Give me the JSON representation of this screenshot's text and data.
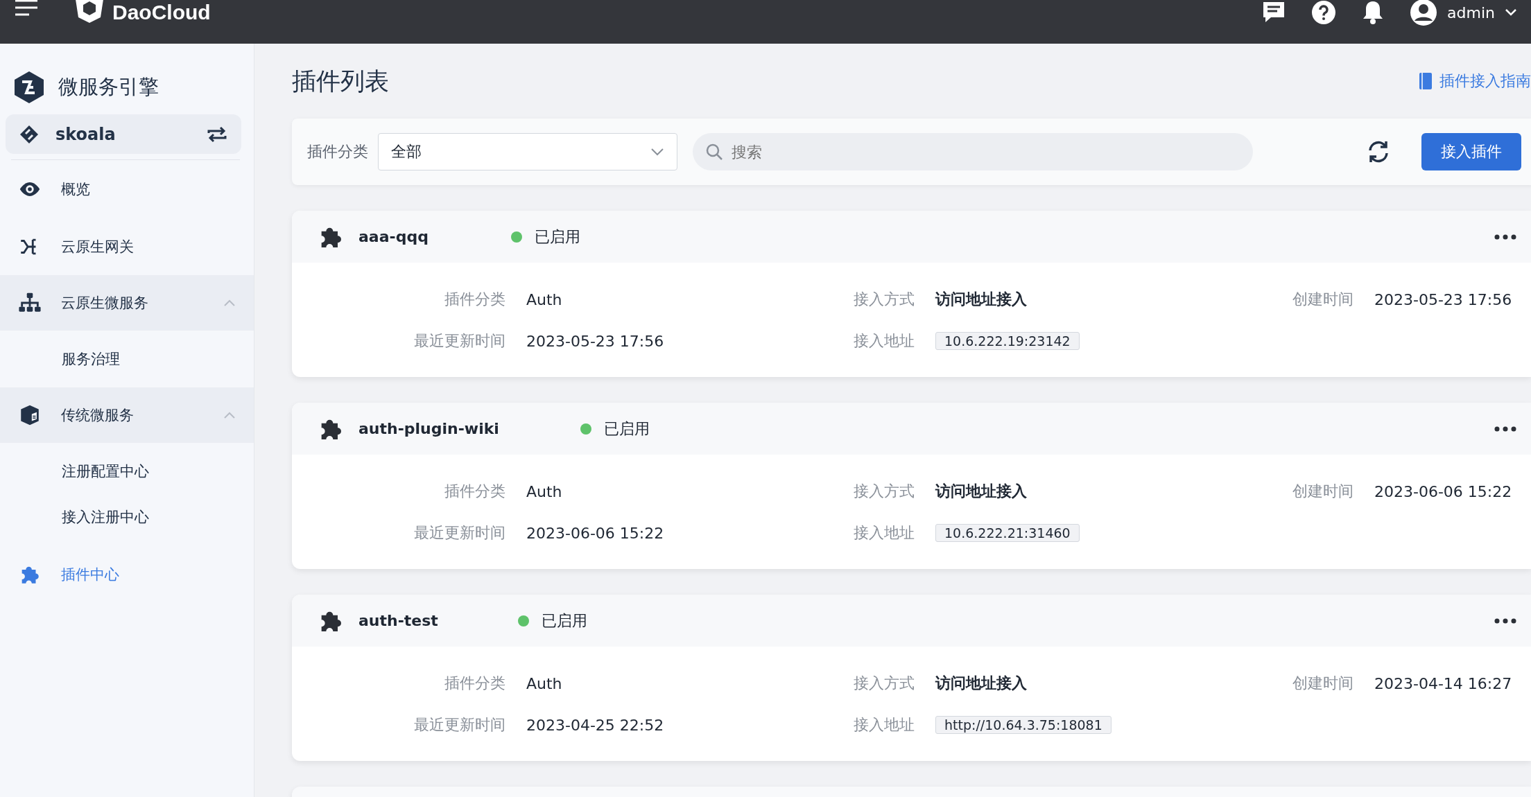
{
  "topbar": {
    "brand": "DaoCloud",
    "user": "admin"
  },
  "sidebar": {
    "title": "微服务引擎",
    "workspace": "skoala",
    "items": [
      {
        "label": "概览",
        "selected": false
      },
      {
        "label": "云原生网关",
        "selected": false
      },
      {
        "label": "云原生微服务",
        "selected": false,
        "expanded": true,
        "children": [
          {
            "label": "服务治理",
            "selected": false
          }
        ]
      },
      {
        "label": "传统微服务",
        "selected": false,
        "expanded": true,
        "children": [
          {
            "label": "注册配置中心",
            "selected": false
          },
          {
            "label": "接入注册中心",
            "selected": false
          }
        ]
      },
      {
        "label": "插件中心",
        "selected": true
      }
    ]
  },
  "page": {
    "title": "插件列表",
    "guide_link": "插件接入指南"
  },
  "toolbar": {
    "category_label": "插件分类",
    "category_value": "全部",
    "search_placeholder": "搜索",
    "add_button": "接入插件"
  },
  "plugins": [
    {
      "name": "aaa-qqq",
      "status": "已启用",
      "color": "#5ec26a",
      "fields": [
        {
          "label": "插件分类",
          "value": "Auth"
        },
        {
          "label": "接入方式",
          "value": "访问地址接入",
          "kind": "bold"
        },
        {
          "label": "创建时间",
          "value": "2023-05-23 17:56"
        },
        {
          "label": "最近更新时间",
          "value": "2023-05-23 17:56"
        },
        {
          "label": "接入地址",
          "value": "10.6.222.19:23142",
          "kind": "tag"
        }
      ]
    },
    {
      "name": "auth-plugin-wiki",
      "status": "已启用",
      "color": "#5ec26a",
      "fields": [
        {
          "label": "插件分类",
          "value": "Auth"
        },
        {
          "label": "接入方式",
          "value": "访问地址接入",
          "kind": "bold"
        },
        {
          "label": "创建时间",
          "value": "2023-06-06 15:22"
        },
        {
          "label": "最近更新时间",
          "value": "2023-06-06 15:22"
        },
        {
          "label": "接入地址",
          "value": "10.6.222.21:31460",
          "kind": "tag"
        }
      ]
    },
    {
      "name": "auth-test",
      "status": "已启用",
      "color": "#5ec26a",
      "fields": [
        {
          "label": "插件分类",
          "value": "Auth"
        },
        {
          "label": "接入方式",
          "value": "访问地址接入",
          "kind": "bold"
        },
        {
          "label": "创建时间",
          "value": "2023-04-14 16:27"
        },
        {
          "label": "最近更新时间",
          "value": "2023-04-25 22:52"
        },
        {
          "label": "接入地址",
          "value": "http://10.64.3.75:18081",
          "kind": "tag"
        }
      ]
    }
  ]
}
